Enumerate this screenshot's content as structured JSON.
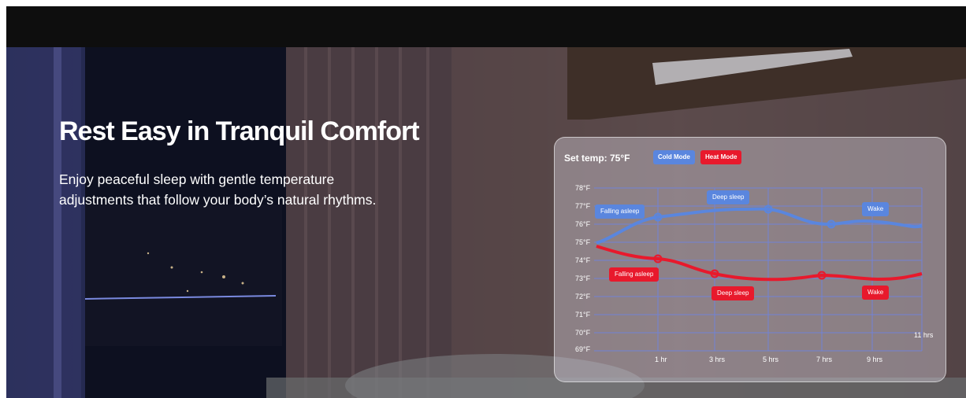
{
  "hero": {
    "headline": "Rest Easy in Tranquil Comfort",
    "subtext": "Enjoy peaceful sleep with gentle temperature adjustments that follow your body’s natural rhythms."
  },
  "panel": {
    "set_temp": "Set temp: 75°F",
    "cold_mode": "Cold Mode",
    "heat_mode": "Heat Mode",
    "y_axis": [
      "78°F",
      "77°F",
      "76°F",
      "75°F",
      "74°F",
      "73°F",
      "72°F",
      "71°F",
      "70°F",
      "69°F"
    ],
    "x_axis": [
      "1 hr",
      "3 hrs",
      "5 hrs",
      "7 hrs",
      "9 hrs",
      "11 hrs"
    ],
    "cold_tags": {
      "falling_asleep": "Falling asleep",
      "deep_sleep": "Deep sleep",
      "wake": "Wake"
    },
    "heat_tags": {
      "falling_asleep": "Falling asleep",
      "deep_sleep": "Deep sleep",
      "wake": "Wake"
    }
  },
  "colors": {
    "cold": "#5a86de",
    "heat": "#e8192c"
  }
}
